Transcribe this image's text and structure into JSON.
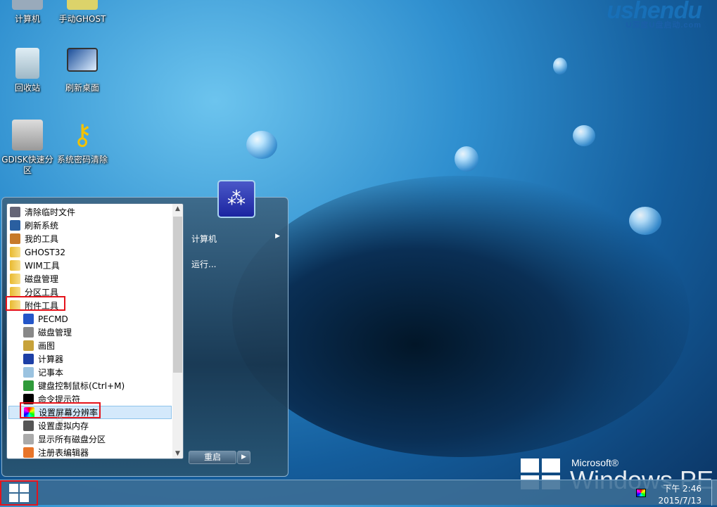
{
  "desktop": {
    "icons": [
      {
        "label": "计算机",
        "icon": "computer-icon"
      },
      {
        "label": "手动GHOST",
        "icon": "ghost-icon"
      },
      {
        "label": "回收站",
        "icon": "recycle-bin-icon"
      },
      {
        "label": "刷新桌面",
        "icon": "refresh-desktop-icon"
      },
      {
        "label": "GDISK快速分区",
        "icon": "gdisk-icon"
      },
      {
        "label": "系统密码清除",
        "icon": "key-icon"
      }
    ],
    "brand": {
      "name": "ushendu",
      "tagline": "U深度U盘启动.com"
    },
    "os_logo": {
      "microsoft": "Microsoft®",
      "product": "Windows PE"
    }
  },
  "start_menu": {
    "items": [
      {
        "label": "清除临时文件",
        "level": 0,
        "icon": "cleanup-icon"
      },
      {
        "label": "刷新系统",
        "level": 0,
        "icon": "refresh-icon"
      },
      {
        "label": "我的工具",
        "level": 0,
        "icon": "toolbox-icon"
      },
      {
        "label": "GHOST32",
        "level": 0,
        "icon": "folder-icon"
      },
      {
        "label": "WIM工具",
        "level": 0,
        "icon": "folder-icon"
      },
      {
        "label": "磁盘管理",
        "level": 0,
        "icon": "folder-icon"
      },
      {
        "label": "分区工具",
        "level": 0,
        "icon": "folder-icon"
      },
      {
        "label": "附件工具",
        "level": 0,
        "icon": "folder-icon"
      },
      {
        "label": "PECMD",
        "level": 1,
        "icon": "help-icon"
      },
      {
        "label": "磁盘管理",
        "level": 1,
        "icon": "disk-icon"
      },
      {
        "label": "画图",
        "level": 1,
        "icon": "paint-icon"
      },
      {
        "label": "计算器",
        "level": 1,
        "icon": "calculator-icon"
      },
      {
        "label": "记事本",
        "level": 1,
        "icon": "notepad-icon"
      },
      {
        "label": "键盘控制鼠标(Ctrl+M)",
        "level": 1,
        "icon": "keyboard-mouse-icon"
      },
      {
        "label": "命令提示符",
        "level": 1,
        "icon": "cmd-icon"
      },
      {
        "label": "设置屏幕分辨率",
        "level": 1,
        "icon": "display-resolution-icon"
      },
      {
        "label": "设置虚拟内存",
        "level": 1,
        "icon": "memory-icon"
      },
      {
        "label": "显示所有磁盘分区",
        "level": 1,
        "icon": "drive-icon"
      },
      {
        "label": "注册表编辑器",
        "level": 1,
        "icon": "registry-icon"
      }
    ],
    "right": {
      "computer": "计算机",
      "run": "运行...",
      "restart": "重启"
    }
  },
  "taskbar": {
    "time": "下午 2:46",
    "date": "2015/7/13"
  },
  "colors": {
    "highlight": "#e5131b",
    "selection": "#d4e9fb"
  }
}
